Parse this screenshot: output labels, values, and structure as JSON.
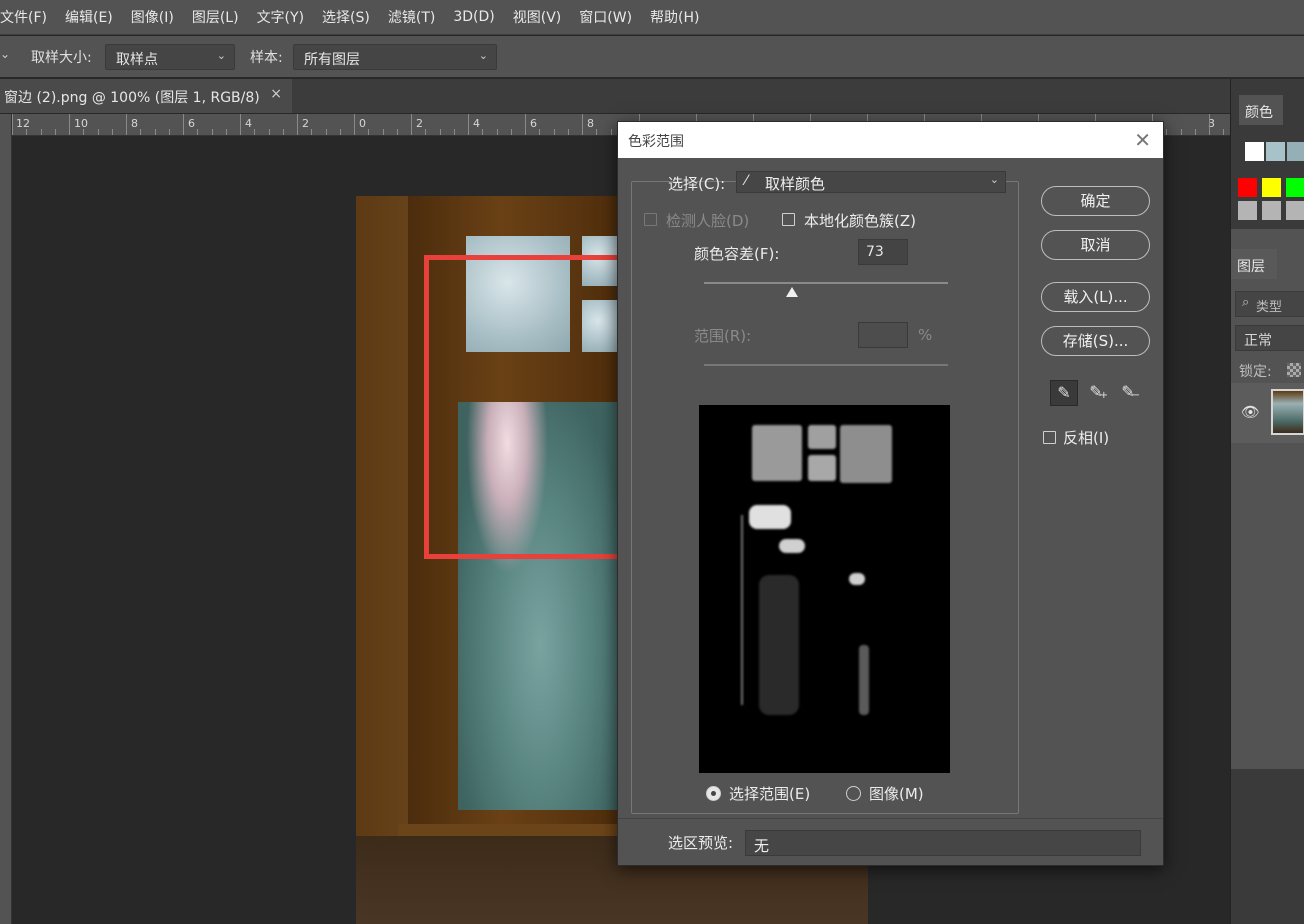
{
  "menu": [
    "文件(F)",
    "编辑(E)",
    "图像(I)",
    "图层(L)",
    "文字(Y)",
    "选择(S)",
    "滤镜(T)",
    "3D(D)",
    "视图(V)",
    "窗口(W)",
    "帮助(H)"
  ],
  "options": {
    "sample_size_label": "取样大小:",
    "sample_size_value": "取样点",
    "sample_label": "样本:",
    "sample_value": "所有图层"
  },
  "document_tab": {
    "title": "窗边 (2).png @ 100% (图层 1, RGB/8)",
    "close": "×"
  },
  "ruler_labels": [
    "12",
    "10",
    "8",
    "6",
    "4",
    "2",
    "0",
    "2",
    "4",
    "6",
    "8",
    "3"
  ],
  "panels": {
    "color_tab": "颜色",
    "layers_tab": "图层",
    "type_filter": "类型",
    "blend_mode": "正常",
    "lock_label": "锁定:",
    "swatch_colors": [
      "#ffffff",
      "#a7c2c8",
      "#94b0b6",
      "#ff0000",
      "#ffff00",
      "#00ff00",
      "#b4b4b4",
      "#b4b4b4",
      "#b4b4b4"
    ]
  },
  "dialog": {
    "title": "色彩范围",
    "select_label": "选择(C):",
    "select_value": "取样颜色",
    "detect_faces": "检测人脸(D)",
    "localized_clusters": "本地化颜色簇(Z)",
    "fuzziness_label": "颜色容差(F):",
    "fuzziness_value": "73",
    "fuzziness_fraction": 0.36,
    "range_label": "范围(R):",
    "range_unit": "%",
    "radio_selection": "选择范围(E)",
    "radio_image": "图像(M)",
    "btn_ok": "确定",
    "btn_cancel": "取消",
    "btn_load": "载入(L)...",
    "btn_save": "存储(S)...",
    "invert": "反相(I)",
    "preview_label": "选区预览:",
    "preview_value": "无"
  }
}
